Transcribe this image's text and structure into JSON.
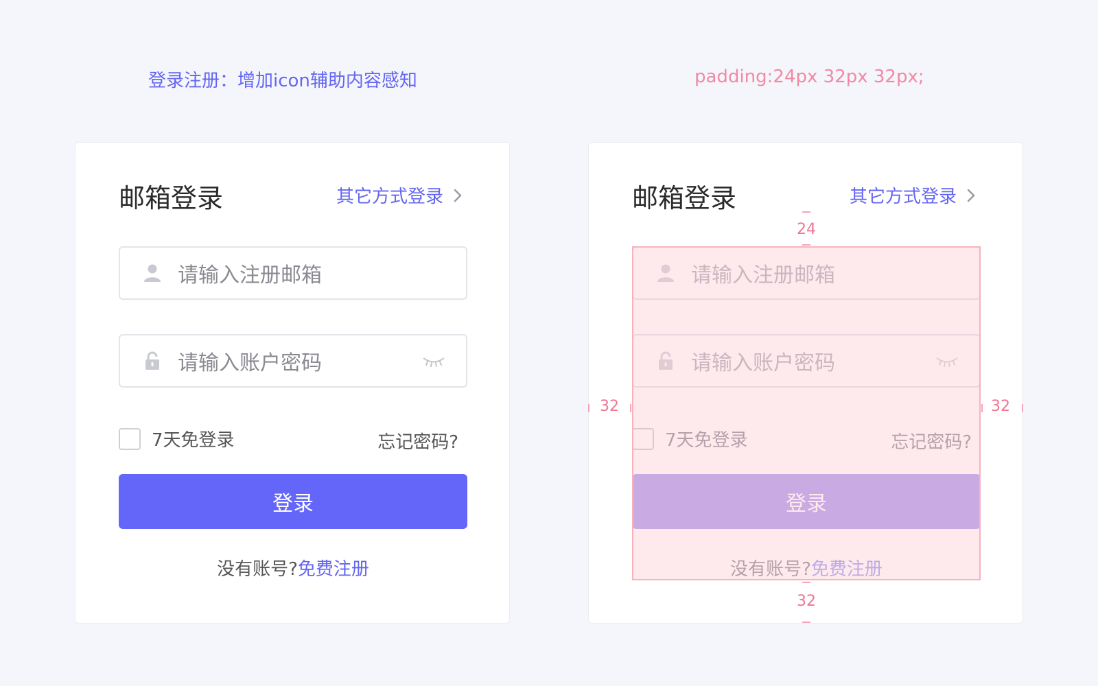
{
  "captions": {
    "left": "登录注册：增加icon辅助内容感知",
    "right": "padding:24px 32px 32px;"
  },
  "card": {
    "title": "邮箱登录",
    "other_login": "其它方式登录",
    "email_placeholder": "请输入注册邮箱",
    "password_placeholder": "请输入账户密码",
    "remember_label": "7天免登录",
    "forgot_label": "忘记密码?",
    "login_label": "登录",
    "no_account": "没有账号?",
    "register": "免费注册"
  },
  "annotations": {
    "top": "24",
    "left": "32",
    "right": "32",
    "bottom": "32"
  },
  "icons": {
    "user": "user-icon",
    "lock": "lock-icon",
    "eye": "eye-closed-icon",
    "chevron": "chevron-right-icon"
  },
  "colors": {
    "accent": "#6466f9",
    "annotation": "#f07595",
    "background": "#f5f6fb"
  }
}
